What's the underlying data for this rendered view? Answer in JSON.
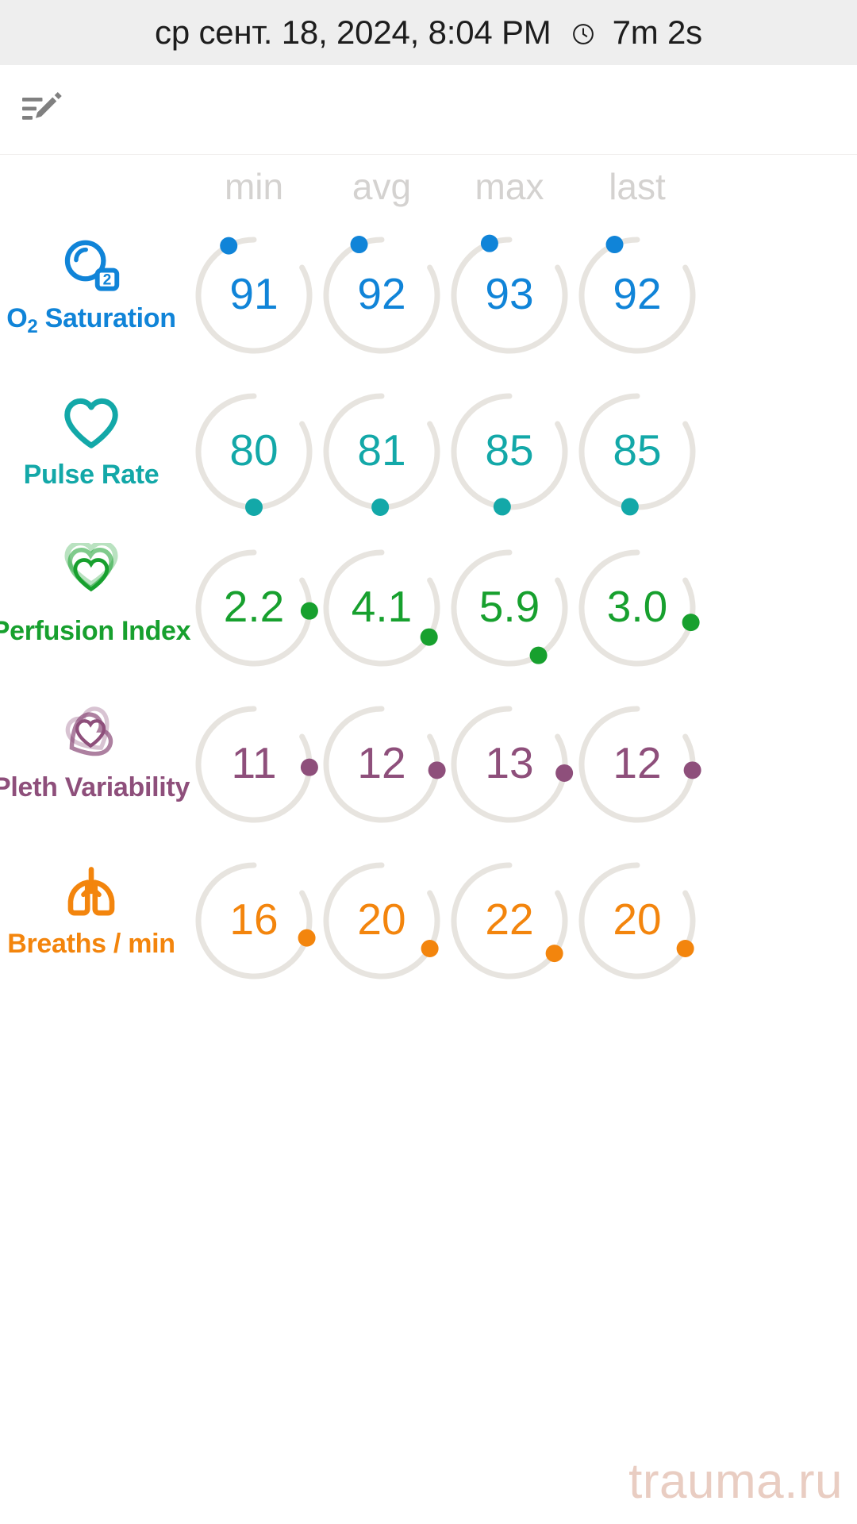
{
  "header": {
    "datetime": "ср сент. 18, 2024, 8:04 PM",
    "clock_icon": "clock-icon",
    "duration": "7m 2s"
  },
  "toolbar": {
    "note_edit_icon": "note-edit-icon",
    "note_edit_color": "#808080"
  },
  "columns": [
    {
      "key": "min",
      "label": "min"
    },
    {
      "key": "avg",
      "label": "avg"
    },
    {
      "key": "max",
      "label": "max"
    },
    {
      "key": "last",
      "label": "last"
    }
  ],
  "header_color": "#d4d2d0",
  "gauge_track_color": "#e7e4df",
  "watermark": "trauma.ru",
  "watermark_color": "#e9cdc2",
  "chart_data": {
    "type": "table",
    "title": "ср сент. 18, 2024, 8:04 PM 7m 2s",
    "categories": [
      "min",
      "avg",
      "max",
      "last"
    ],
    "series": [
      {
        "name": "O2 Saturation",
        "values": [
          91,
          92,
          93,
          92
        ]
      },
      {
        "name": "Pulse Rate",
        "values": [
          80,
          81,
          85,
          85
        ]
      },
      {
        "name": "Perfusion Index",
        "values": [
          2.2,
          4.1,
          5.9,
          3.0
        ]
      },
      {
        "name": "Pleth Variability",
        "values": [
          11,
          12,
          13,
          12
        ]
      },
      {
        "name": "Breaths / min",
        "values": [
          16,
          20,
          22,
          20
        ]
      }
    ]
  },
  "metrics": [
    {
      "id": "o2-saturation",
      "icon": "o2-bubble-icon",
      "name_html": "O<sub>2</sub> Saturation",
      "name": "O2 Saturation",
      "color": "#1084d8",
      "cells": [
        {
          "col": "min",
          "value": "91",
          "dot_frac": 0.91
        },
        {
          "col": "avg",
          "value": "92",
          "dot_frac": 0.92
        },
        {
          "col": "max",
          "value": "93",
          "dot_frac": 0.93
        },
        {
          "col": "last",
          "value": "92",
          "dot_frac": 0.92
        }
      ]
    },
    {
      "id": "pulse-rate",
      "icon": "heart-outline-icon",
      "name_html": "Pulse Rate",
      "name": "Pulse Rate",
      "color": "#13a8a8",
      "cells": [
        {
          "col": "min",
          "value": "80",
          "dot_frac": 0.4
        },
        {
          "col": "avg",
          "value": "81",
          "dot_frac": 0.405
        },
        {
          "col": "max",
          "value": "85",
          "dot_frac": 0.425
        },
        {
          "col": "last",
          "value": "85",
          "dot_frac": 0.425
        }
      ]
    },
    {
      "id": "perfusion-index",
      "icon": "triple-heart-icon",
      "name_html": "Perfusion Index",
      "name": "Perfusion Index",
      "color": "#17a02e",
      "cells": [
        {
          "col": "min",
          "value": "2.2",
          "dot_frac": 0.11
        },
        {
          "col": "avg",
          "value": "4.1",
          "dot_frac": 0.205
        },
        {
          "col": "max",
          "value": "5.9",
          "dot_frac": 0.295
        },
        {
          "col": "last",
          "value": "3.0",
          "dot_frac": 0.15
        }
      ]
    },
    {
      "id": "pleth-variability",
      "icon": "overlapping-hearts-icon",
      "name_html": "Pleth Variability",
      "name": "Pleth Variability",
      "color": "#8e4f7b",
      "cells": [
        {
          "col": "min",
          "value": "11",
          "dot_frac": 0.11
        },
        {
          "col": "avg",
          "value": "12",
          "dot_frac": 0.12
        },
        {
          "col": "max",
          "value": "13",
          "dot_frac": 0.13
        },
        {
          "col": "last",
          "value": "12",
          "dot_frac": 0.12
        }
      ]
    },
    {
      "id": "breaths-per-min",
      "icon": "lungs-icon",
      "name_html": "Breaths / min",
      "name": "Breaths / min",
      "color": "#f3850d",
      "cells": [
        {
          "col": "min",
          "value": "16",
          "dot_frac": 0.16
        },
        {
          "col": "avg",
          "value": "20",
          "dot_frac": 0.2
        },
        {
          "col": "max",
          "value": "22",
          "dot_frac": 0.22
        },
        {
          "col": "last",
          "value": "20",
          "dot_frac": 0.2
        }
      ]
    }
  ]
}
